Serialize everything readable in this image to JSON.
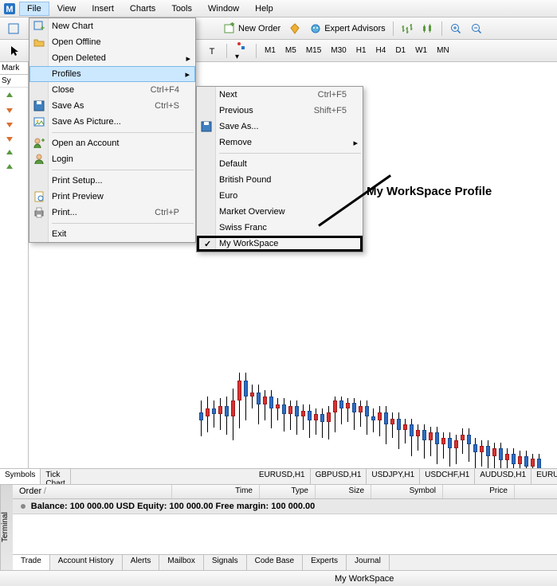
{
  "menubar": {
    "items": [
      "File",
      "View",
      "Insert",
      "Charts",
      "Tools",
      "Window",
      "Help"
    ]
  },
  "toolbar1": {
    "new_order": "New Order",
    "expert_advisors": "Expert Advisors"
  },
  "toolbar2": {
    "timeframes": [
      "M1",
      "M5",
      "M15",
      "M30",
      "H1",
      "H4",
      "D1",
      "W1",
      "MN"
    ]
  },
  "file_menu": {
    "new_chart": "New Chart",
    "open_offline": "Open Offline",
    "open_deleted": "Open Deleted",
    "profiles": "Profiles",
    "close": "Close",
    "close_sc": "Ctrl+F4",
    "save_as": "Save As",
    "save_as_sc": "Ctrl+S",
    "save_as_picture": "Save As Picture...",
    "open_account": "Open an Account",
    "login": "Login",
    "print_setup": "Print Setup...",
    "print_preview": "Print Preview",
    "print": "Print...",
    "print_sc": "Ctrl+P",
    "exit": "Exit"
  },
  "profiles_menu": {
    "next": "Next",
    "next_sc": "Ctrl+F5",
    "previous": "Previous",
    "previous_sc": "Shift+F5",
    "save_as": "Save As...",
    "remove": "Remove",
    "default": "Default",
    "british_pound": "British Pound",
    "euro": "Euro",
    "market_overview": "Market Overview",
    "swiss_franc": "Swiss Franc",
    "my_workspace": "My WorkSpace"
  },
  "annotation": "My WorkSpace Profile",
  "market_panel": {
    "title": "Mark",
    "sym": "Sy"
  },
  "bottom_tabs": {
    "symbols": "Symbols",
    "tick_chart": "Tick Chart",
    "pairs": [
      "EURUSD,H1",
      "GBPUSD,H1",
      "USDJPY,H1",
      "USDCHF,H1",
      "AUDUSD,H1",
      "EURUS..."
    ]
  },
  "terminal": {
    "side": "Terminal",
    "headers": {
      "order": "Order",
      "time": "Time",
      "type": "Type",
      "size": "Size",
      "symbol": "Symbol",
      "price": "Price"
    },
    "balance_row": "Balance: 100 000.00 USD  Equity: 100 000.00  Free margin: 100 000.00",
    "tabs": [
      "Trade",
      "Account History",
      "Alerts",
      "Mailbox",
      "Signals",
      "Code Base",
      "Experts",
      "Journal"
    ]
  },
  "statusbar": {
    "profile": "My WorkSpace"
  }
}
